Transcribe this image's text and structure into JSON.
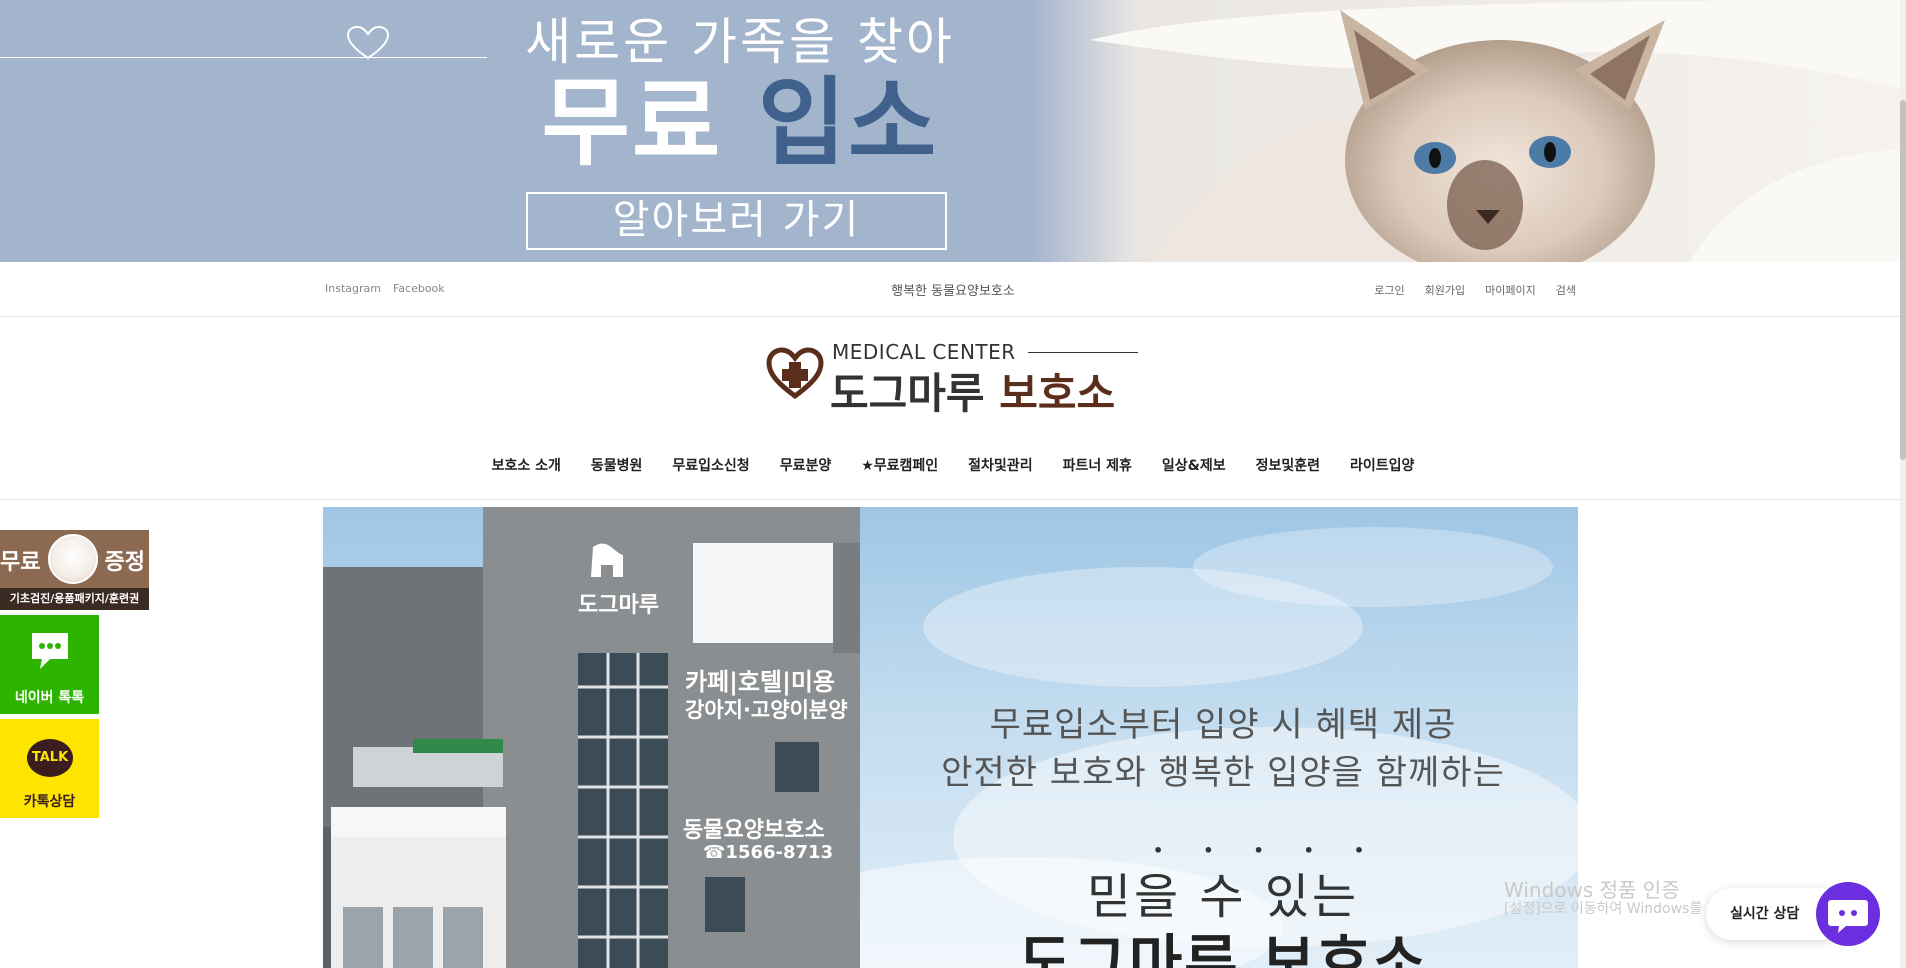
{
  "banner": {
    "headline": "새로운 가족을 찾아",
    "big_white": "무료",
    "big_blue": "입소",
    "cta": "알아보러 가기",
    "colors": {
      "background": "#a3b4cd",
      "accent": "#3f618b"
    }
  },
  "utility": {
    "social": [
      "Instagram",
      "Facebook"
    ],
    "tagline": "행복한 동물요양보호소",
    "links": [
      "로그인",
      "회원가입",
      "마이페이지",
      "검색"
    ]
  },
  "logo": {
    "sub": "MEDICAL CENTER",
    "name_main": "도그마루",
    "name_accent": "보호소",
    "colors": {
      "accent": "#5a2e1b"
    }
  },
  "nav": {
    "items": [
      "보호소 소개",
      "동물병원",
      "무료입소신청",
      "무료분양",
      "★무료캠페인",
      "절차및관리",
      "파트너 제휴",
      "일상&제보",
      "정보및훈련",
      "라이트입양"
    ]
  },
  "hero": {
    "building_logo": "도그마루",
    "sign1": "카페|호텔|미용",
    "sign2": "강아지·고양이분양",
    "sign3": "동물요양보호소",
    "phone": "☎1566-8713",
    "line1": "무료입소부터 입양 시 혜택 제공",
    "line2": "안전한 보호와 행복한 입양을 함께하는",
    "dots": "•••••",
    "trust": "믿을 수 있는",
    "shelter": "도그마루 보호소"
  },
  "floating": {
    "free_left": "무료",
    "free_right": "증정",
    "free_bar": "기초검진/용품패키지/훈련권",
    "naver": "네이버 톡톡",
    "kakao_icon": "TALK",
    "kakao": "카톡상담"
  },
  "watermark": {
    "title": "Windows 정품 인증",
    "desc": "[설정]으로 이동하여 Windows를 정품 인증합니다."
  },
  "chat": {
    "label": "실시간 상담",
    "color": "#6b2fe0"
  }
}
